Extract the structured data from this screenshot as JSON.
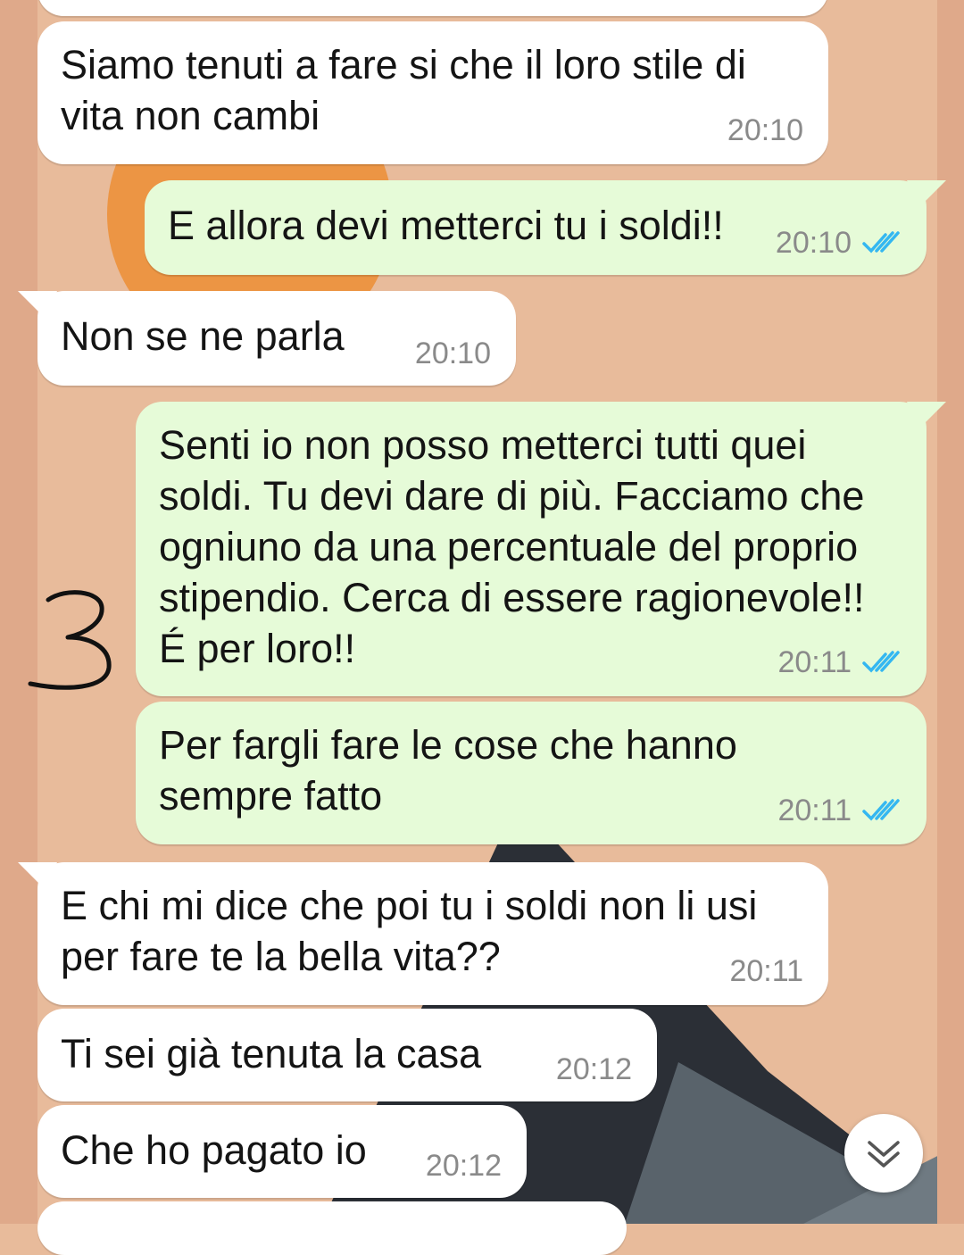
{
  "colors": {
    "wallpaper": "#e8bb9b",
    "incoming_bubble": "#ffffff",
    "outgoing_bubble": "#e6fbd8",
    "timestamp": "#8a8a8a",
    "read_ticks": "#34b7f1"
  },
  "chat": {
    "messages": [
      {
        "direction": "incoming",
        "text": "Siamo tenuti a fare si che il loro stile di\nvita non cambi",
        "time": "20:10"
      },
      {
        "direction": "outgoing",
        "text": "E allora devi metterci tu i soldi!!",
        "time": "20:10",
        "status_icon": "double-check-icon"
      },
      {
        "direction": "incoming",
        "text": "Non se ne parla",
        "time": "20:10"
      },
      {
        "direction": "outgoing",
        "text": "Senti io non posso metterci tutti quei\nsoldi. Tu devi dare di più. Facciamo che\nogniuno da una percentuale del proprio\nstipendio. Cerca di essere ragionevole!!\nÉ per loro!!",
        "time": "20:11",
        "status_icon": "double-check-icon"
      },
      {
        "direction": "outgoing",
        "text": "Per fargli fare le cose che hanno\nsempre fatto",
        "time": "20:11",
        "status_icon": "double-check-icon"
      },
      {
        "direction": "incoming",
        "text": "E chi mi dice che poi tu i soldi non li usi\nper fare te la bella vita??",
        "time": "20:11"
      },
      {
        "direction": "incoming",
        "text": "Ti sei già tenuta la casa",
        "time": "20:12"
      },
      {
        "direction": "incoming",
        "text": "Che ho pagato io",
        "time": "20:12"
      }
    ]
  },
  "annotation": {
    "label": "3"
  },
  "scroll_button": {
    "icon": "chevron-double-down-icon"
  }
}
